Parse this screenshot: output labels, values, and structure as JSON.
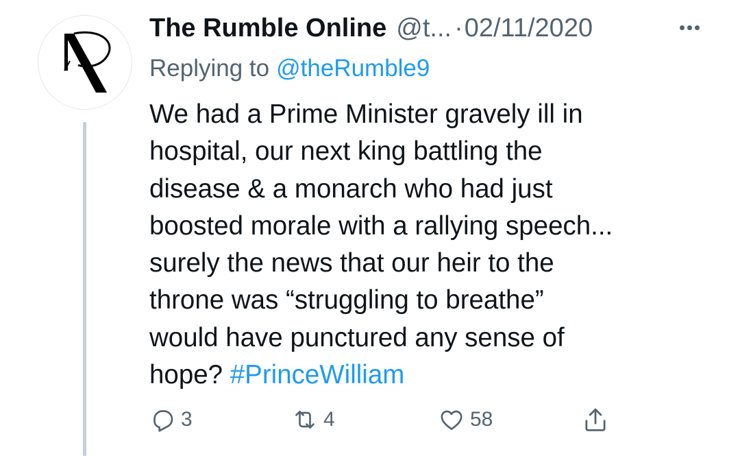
{
  "tweet": {
    "display_name": "The Rumble Online",
    "handle": "@t...",
    "separator": "·",
    "date": "02/11/2020",
    "more_icon": "more-horizontal-icon",
    "replying_label": "Replying to",
    "replying_handle": "@theRumble9",
    "text_lines": [
      "We had a Prime Minister gravely ill in",
      "hospital, our next king battling the",
      "disease & a monarch who had just",
      "boosted morale with a rallying speech...",
      "surely the news that our heir to the",
      "throne was “struggling to breathe”",
      "would have punctured any sense of",
      "hope?"
    ],
    "hashtag": "#PrinceWilliam",
    "actions": {
      "reply_count": "3",
      "retweet_count": "4",
      "like_count": "58",
      "reply_icon": "reply-icon",
      "retweet_icon": "retweet-icon",
      "like_icon": "heart-icon",
      "share_icon": "share-icon"
    }
  },
  "colors": {
    "text": "#0f1419",
    "secondary": "#536471",
    "link": "#1d9bf0",
    "thread_line": "#c4cfd6"
  }
}
